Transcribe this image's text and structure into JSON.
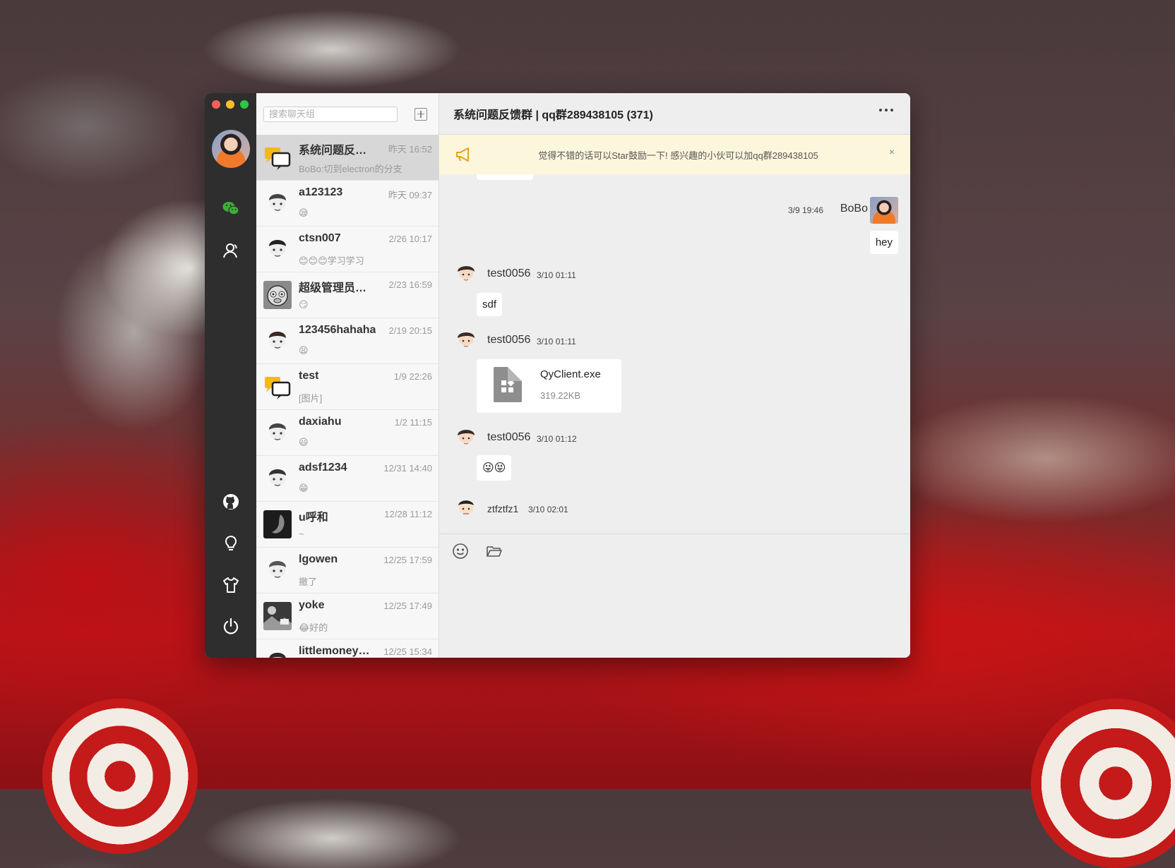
{
  "window": {
    "controls": [
      "close",
      "minimize",
      "zoom"
    ]
  },
  "sidebar": {
    "icons": [
      "wechat-chat-icon",
      "contacts-icon",
      "github-icon",
      "bulb-icon",
      "tshirt-icon",
      "power-icon"
    ],
    "accent": "#3cb034"
  },
  "search": {
    "placeholder": "搜索聊天组",
    "value": ""
  },
  "chats": [
    {
      "name": "系统问题反馈群",
      "time": "昨天 16:52",
      "preview": "BoBo:切到electron的分支",
      "active": true
    },
    {
      "name": "a123123",
      "time": "昨天 09:37",
      "preview": "😪"
    },
    {
      "name": "ctsn007",
      "time": "2/26 10:17",
      "preview": "😊😊😊学习学习"
    },
    {
      "name": "超级管理员王大大",
      "time": "2/23 16:59",
      "preview": "😏"
    },
    {
      "name": "123456hahaha",
      "time": "2/19 20:15",
      "preview": "😫"
    },
    {
      "name": "test",
      "time": "1/9 22:26",
      "preview": "[图片]"
    },
    {
      "name": "daxiahu",
      "time": "1/2 11:15",
      "preview": "😃"
    },
    {
      "name": "adsf1234",
      "time": "12/31 14:40",
      "preview": "😁"
    },
    {
      "name": "u呼和",
      "time": "12/28 11:12",
      "preview": "~"
    },
    {
      "name": "lgowen",
      "time": "12/25 17:59",
      "preview": "撤了"
    },
    {
      "name": "yoke",
      "time": "12/25 17:49",
      "preview": "😂好的"
    },
    {
      "name": "littlemoneyhaha",
      "time": "12/25 15:34",
      "preview": ""
    }
  ],
  "header": {
    "title": "系统问题反馈群 | qq群289438105 (371)"
  },
  "notice": {
    "text": "觉得不错的话可以Star鼓励一下! 感兴趣的小伙可以加qq群289438105",
    "close": "×"
  },
  "messages": [
    {
      "sender": "BoBo",
      "time": "3/9 19:46",
      "text": "hey",
      "self": true
    },
    {
      "sender": "test0056",
      "time": "3/10 01:11",
      "text": "sdf"
    },
    {
      "sender": "test0056",
      "time": "3/10 01:11",
      "file": {
        "name": "QyClient.exe",
        "size": "319.22KB"
      }
    },
    {
      "sender": "test0056",
      "time": "3/10 01:12",
      "text": "😜😝"
    },
    {
      "sender": "ztfztfz1",
      "time": "3/10 02:01",
      "text": ""
    }
  ],
  "composer": {
    "tools": [
      "emoji-icon",
      "folder-icon"
    ]
  }
}
